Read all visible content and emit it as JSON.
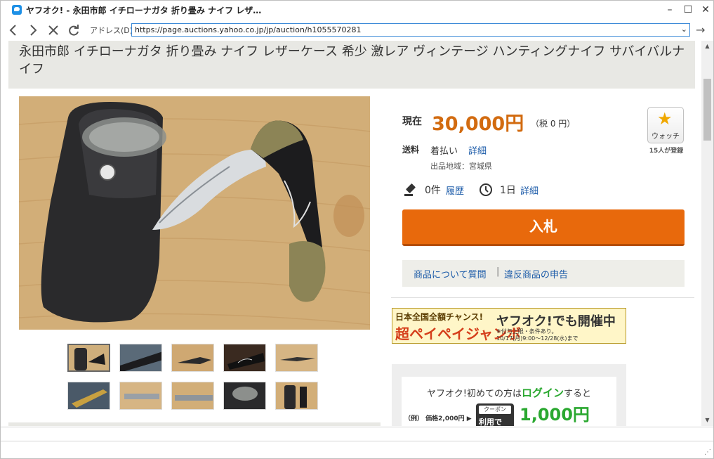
{
  "window": {
    "title": "ヤフオク! - 永田市郎 イチローナガタ 折り畳み ナイフ レザ…"
  },
  "navbar": {
    "address_label": "アドレス(D)",
    "url": "https://page.auctions.yahoo.co.jp/jp/auction/h1055570281"
  },
  "item": {
    "title": "永田市郎 イチローナガタ 折り畳み ナイフ レザーケース 希少 激レア ヴィンテージ ハンティングナイフ サバイバルナイフ"
  },
  "price": {
    "label": "現在",
    "value": "30,000円",
    "tax": "（税 0 円）"
  },
  "watch": {
    "label": "ウォッチ",
    "count": "15人が登録"
  },
  "shipping": {
    "label": "送料",
    "value": "着払い",
    "detail": "詳細",
    "origin": "出品地域：宮城県"
  },
  "bids": {
    "count": "0件",
    "history": "履歴"
  },
  "time": {
    "left": "1日",
    "detail": "詳細"
  },
  "bid_button": "入札",
  "links": {
    "question": "商品について質問",
    "separator": "|",
    "report": "違反商品の申告"
  },
  "banner": {
    "line1": "日本全国全額チャンス!",
    "jumbo": "超ペイペイジャンボ",
    "headline": "ヤフオク!でも開催中",
    "note1": "※付与上限・条件あり。",
    "note2": "10/17(月)9:00～12/28(水)まで"
  },
  "promo": {
    "text_before": "ヤフオク!初めての方は",
    "login": "ログイン",
    "text_after": "すると",
    "example": "（例） 価格2,000円 ▶",
    "coupon_tag": "クーポン",
    "coupon_text": "利用で",
    "amount": "1,000円"
  },
  "icons": {
    "favicon": "speech-bubble-icon",
    "watch": "star-icon",
    "bid": "gavel-icon",
    "time": "clock-icon"
  },
  "colors": {
    "price": "#d26b10",
    "bid_button": "#e8690c",
    "link": "#1a5aa8",
    "login": "#2aa830"
  }
}
